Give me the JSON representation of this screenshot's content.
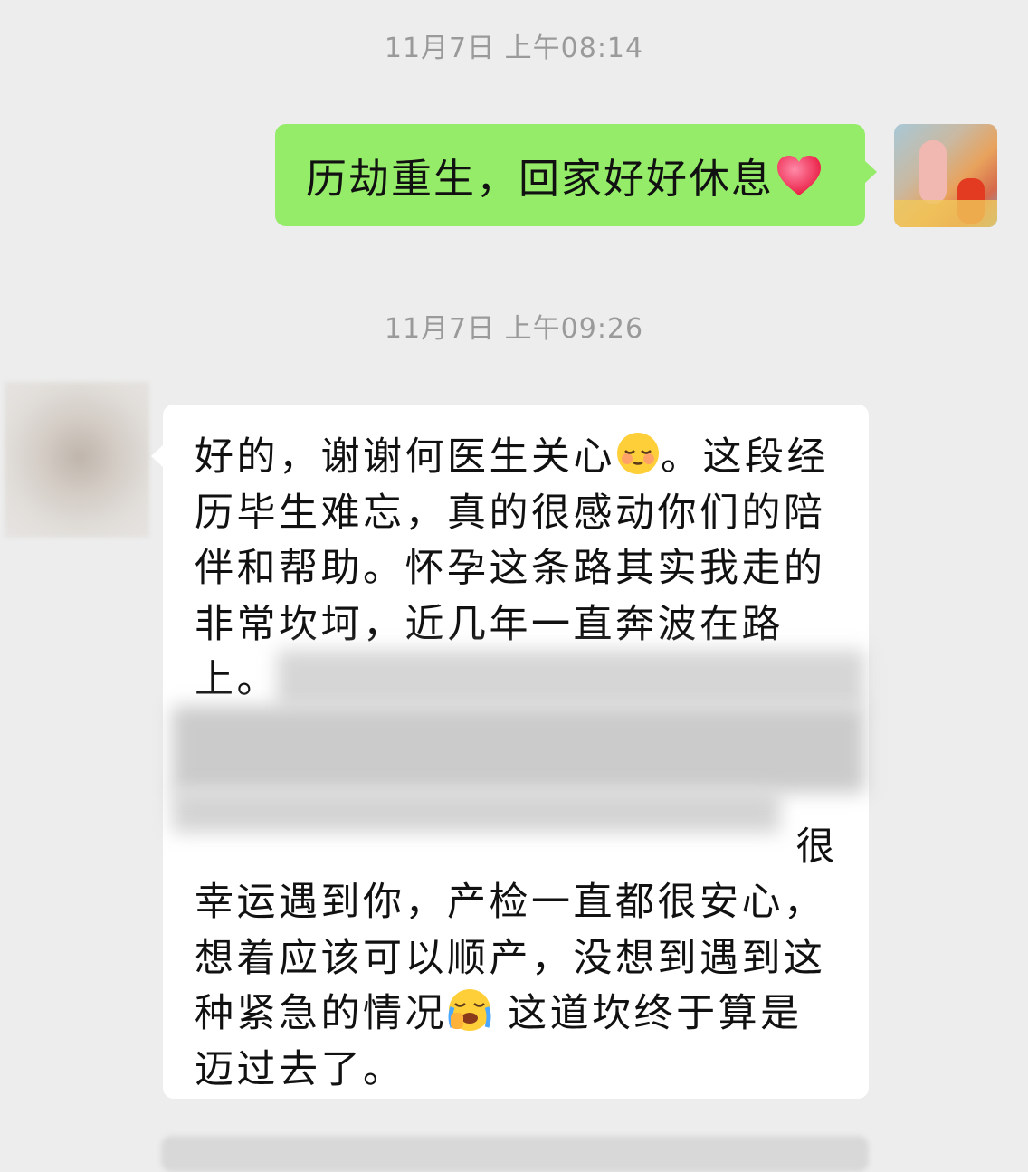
{
  "messages": {
    "timestamp_1": "11月7日 上午08:14",
    "sent_text": "历劫重生，回家好好休息",
    "sent_emoji": "red-heart",
    "timestamp_2": "11月7日 上午09:26",
    "recv_lines": {
      "l1a": "好的，谢谢何医生关心",
      "l1b": "。这段经",
      "l2": "历毕生难忘，真的很感动你们的陪",
      "l3": "伴和帮助。怀孕这条路其实我走的",
      "l4": "非常坎坷，近几年一直奔波在路",
      "l5": "上。",
      "l8": "很",
      "l9": "幸运遇到你，产检一直都很安心，",
      "l10": "想着应该可以顺产，没想到遇到这",
      "l11a": "种紧急的情况",
      "l11b": " 这道坎终于算是",
      "l12": "迈过去了。"
    },
    "recv_emojis": [
      "blushing-face",
      "loudly-crying-face"
    ]
  },
  "colors": {
    "background": "#ededed",
    "sent_bubble": "#95ec69",
    "recv_bubble": "#ffffff",
    "timestamp": "#9a9a9a"
  }
}
